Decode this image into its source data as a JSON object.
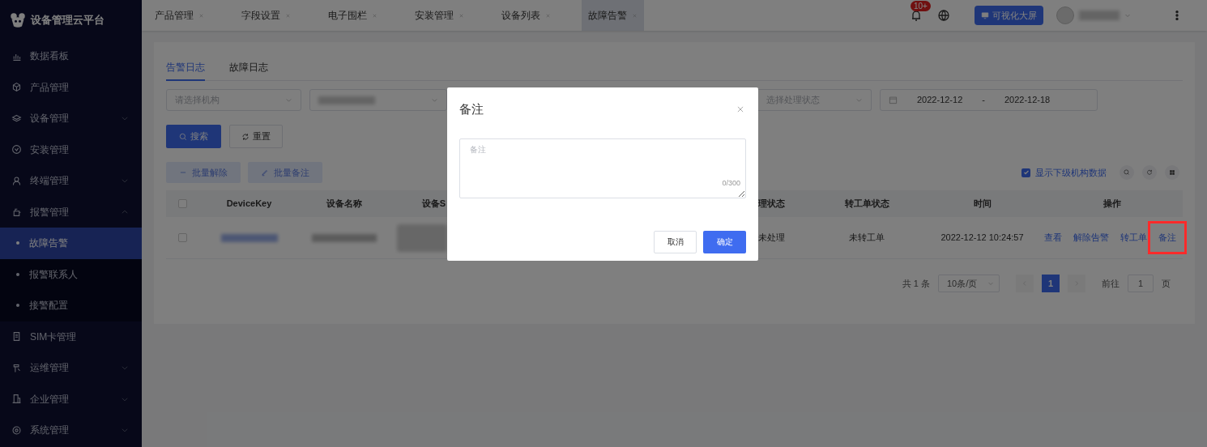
{
  "app": {
    "title": "设备管理云平台"
  },
  "sidebar": {
    "items": [
      {
        "label": "数据看板",
        "selected": false
      },
      {
        "label": "产品管理",
        "selected": false
      },
      {
        "label": "设备管理",
        "selected": false,
        "expanded": false
      },
      {
        "label": "安装管理",
        "selected": false
      },
      {
        "label": "终端管理",
        "selected": false,
        "expanded": false
      },
      {
        "label": "报警管理",
        "selected": false,
        "expanded": true,
        "children": [
          {
            "label": "故障告警",
            "selected": true
          },
          {
            "label": "报警联系人",
            "selected": false
          },
          {
            "label": "接警配置",
            "selected": false
          }
        ]
      },
      {
        "label": "SIM卡管理",
        "selected": false
      },
      {
        "label": "运维管理",
        "selected": false,
        "expanded": false
      },
      {
        "label": "企业管理",
        "selected": false,
        "expanded": false
      },
      {
        "label": "系统管理",
        "selected": false,
        "expanded": false
      }
    ]
  },
  "tabs": [
    {
      "label": "产品管理",
      "selected": false
    },
    {
      "label": "字段设置",
      "selected": false
    },
    {
      "label": "电子围栏",
      "selected": false
    },
    {
      "label": "安装管理",
      "selected": false
    },
    {
      "label": "设备列表",
      "selected": false
    },
    {
      "label": "故障告警",
      "selected": true
    }
  ],
  "header": {
    "notification_badge": "10+",
    "screen_button": "可视化大屏"
  },
  "subtabs": [
    {
      "label": "告警日志",
      "selected": true
    },
    {
      "label": "故障日志",
      "selected": false
    }
  ],
  "filters": {
    "org": {
      "placeholder": "请选择机构"
    },
    "status": {
      "placeholder": "选择处理状态"
    },
    "date_range": {
      "start": "2022-12-12",
      "separator": "-",
      "end": "2022-12-18"
    }
  },
  "buttons": {
    "search": "搜索",
    "reset": "重置",
    "batch": [
      {
        "label": "批量解除",
        "disabled": true
      },
      {
        "label": "批量备注",
        "disabled": true
      }
    ]
  },
  "show_sub_org": {
    "label": "显示下级机构数据",
    "checked": true
  },
  "table": {
    "select_all_checked": false,
    "columns": [
      "DeviceKey",
      "设备名称",
      "设备S",
      "理状态",
      "转工单状态",
      "时间",
      "操作"
    ],
    "rows": [
      {
        "selected": false,
        "status": "未处理",
        "ticket_status": "未转工单",
        "time": "2022-12-12 10:24:57",
        "actions": [
          {
            "label": "查看",
            "highlighted": false
          },
          {
            "label": "解除告警",
            "highlighted": false
          },
          {
            "label": "转工单",
            "highlighted": false
          },
          {
            "label": "备注",
            "highlighted": true
          }
        ]
      }
    ]
  },
  "pagination": {
    "total": "共 1 条",
    "page_size": "10条/页",
    "pages": [
      {
        "label": "1",
        "selected": true
      }
    ],
    "goto_label": "前往",
    "goto_value": "1",
    "page_suffix": "页"
  },
  "modal": {
    "title": "备注",
    "field_placeholder": "备注",
    "counter": "0/300",
    "buttons": [
      {
        "label": "取消",
        "kind": "default"
      },
      {
        "label": "确定",
        "kind": "primary"
      }
    ]
  }
}
